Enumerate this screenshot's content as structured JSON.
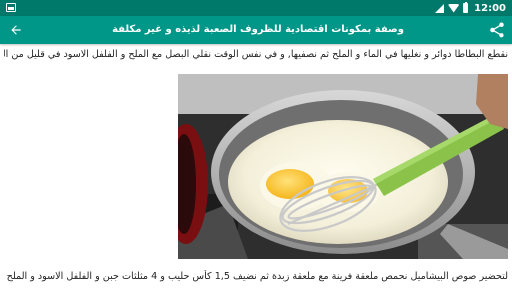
{
  "status_bar": {
    "time": "12:00",
    "icons": [
      "image-icon",
      "signal-icon",
      "wifi-icon",
      "battery-icon"
    ]
  },
  "app_bar": {
    "title": "وصفة بمكونات اقتصادية للظروف الصعبة لذيذه و غير مكلفة",
    "back_icon": "arrow-left-icon",
    "share_icon": "share-icon",
    "color": "#009688",
    "status_color": "#00796b"
  },
  "article": {
    "paragraph_1": "نقطع البطاطا دوائر و نغليها في الماء و الملح ثم نصفيها, و في نفس الوقت نقلي البصل مع الملح و الفلفل الاسود في قليل من الزيت حتى يتكرمل",
    "paragraph_2": "لتحضير صوص البيشاميل نحمص ملعقة فرينة مع ملعقة زبدة ثم نضيف 1,5 كأس حليب و 4 مثلثات جبن و الفلفل الاسود و الملح و نخلط حتى يذوب",
    "image_icon": "cooking-photo"
  }
}
